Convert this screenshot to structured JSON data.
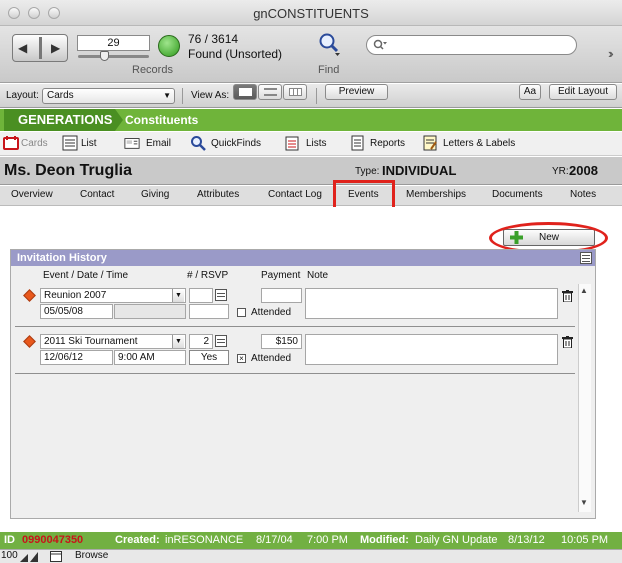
{
  "window": {
    "title": "gnCONSTITUENTS"
  },
  "toolbar": {
    "record_number": "29",
    "found_count": "76 / 3614",
    "found_status": "Found (Unsorted)",
    "records_label": "Records",
    "find_label": "Find",
    "search_placeholder": ""
  },
  "layout_bar": {
    "layout_label": "Layout:",
    "layout_value": "Cards",
    "view_as_label": "View As:",
    "preview_label": "Preview",
    "aa_label": "Aa",
    "edit_layout_label": "Edit Layout"
  },
  "banner": {
    "brand": "GENERATIONS",
    "module": "Constituents"
  },
  "nav": {
    "items": [
      {
        "label": "Cards"
      },
      {
        "label": "List"
      },
      {
        "label": "Email"
      },
      {
        "label": "QuickFinds"
      },
      {
        "label": "Lists"
      },
      {
        "label": "Reports"
      },
      {
        "label": "Letters & Labels"
      }
    ]
  },
  "header": {
    "name": "Ms. Deon Truglia",
    "type_label": "Type:",
    "type_value": "INDIVIDUAL",
    "yr_label": "YR:",
    "yr_value": "2008"
  },
  "tabs": [
    {
      "label": "Overview"
    },
    {
      "label": "Contact"
    },
    {
      "label": "Giving"
    },
    {
      "label": "Attributes"
    },
    {
      "label": "Contact Log"
    },
    {
      "label": "Events"
    },
    {
      "label": "Memberships"
    },
    {
      "label": "Documents"
    },
    {
      "label": "Notes"
    }
  ],
  "panel": {
    "new_label": "New",
    "title": "Invitation History",
    "columns": {
      "event": "Event / Date / Time",
      "rsvp": "# / RSVP",
      "payment": "Payment",
      "note": "Note"
    },
    "rows": [
      {
        "event": "Reunion 2007",
        "date": "05/05/08",
        "time": "",
        "count": "",
        "rsvp": "",
        "payment": "",
        "attended_label": "Attended",
        "attended_mark": ""
      },
      {
        "event": "2011 Ski Tournament",
        "date": "12/06/12",
        "time": "9:00 AM",
        "count": "2",
        "rsvp": "Yes",
        "payment": "$150",
        "attended_label": "Attended",
        "attended_mark": "×"
      }
    ]
  },
  "status": {
    "id_label": "ID",
    "id_value": "0990047350",
    "created_label": "Created:",
    "created_by": "inRESONANCE",
    "created_date": "8/17/04",
    "created_time": "7:00 PM",
    "modified_label": "Modified:",
    "modified_by": "Daily GN Update",
    "modified_date": "8/13/12",
    "modified_time": "10:05 PM"
  },
  "bottom": {
    "zoom": "100",
    "mode": "Browse"
  }
}
